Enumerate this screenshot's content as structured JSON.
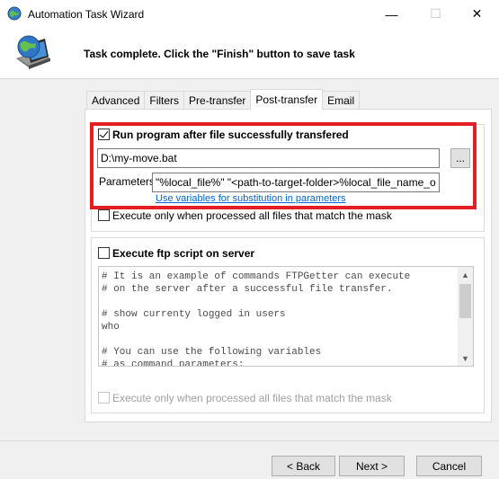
{
  "window": {
    "title": "Automation Task Wizard",
    "controls": {
      "minimize": "—",
      "maximize": "☐",
      "close": "✕"
    }
  },
  "header": {
    "message": "Task complete. Click the \"Finish\" button to save task"
  },
  "tabs": [
    {
      "label": "Advanced",
      "active": false
    },
    {
      "label": "Filters",
      "active": false
    },
    {
      "label": "Pre-transfer",
      "active": false
    },
    {
      "label": "Post-transfer",
      "active": true
    },
    {
      "label": "Email",
      "active": false
    }
  ],
  "post_transfer": {
    "run_program": {
      "label": "Run program after file successfully transfered",
      "checked": true
    },
    "program_path": "D:\\my-move.bat",
    "browse_label": "...",
    "parameters_label": "Parameters",
    "parameters_value": "\"%local_file%\" \"<path-to-target-folder>%local_file_name_o",
    "variables_link": "Use variables for substitution in parameters",
    "execute_only_processed": {
      "label": "Execute only when processed all files that match the mask",
      "checked": false
    },
    "ftp_script": {
      "label": "Execute ftp script on server",
      "checked": false
    },
    "script_lines": [
      "# It is an example of commands FTPGetter can execute",
      "# on the server after a successful file transfer.",
      "",
      "# show currenty logged in users",
      "who",
      "",
      "# You can use the following variables",
      "# as command parameters:"
    ],
    "ftp_execute_only_processed": {
      "label": "Execute only when processed all files that match the mask",
      "checked": false,
      "disabled": true
    }
  },
  "footer": {
    "back_label": "< Back",
    "next_label": "Next >",
    "cancel_label": "Cancel"
  },
  "colors": {
    "highlight_border": "#e31e24",
    "link": "#0066cc"
  }
}
